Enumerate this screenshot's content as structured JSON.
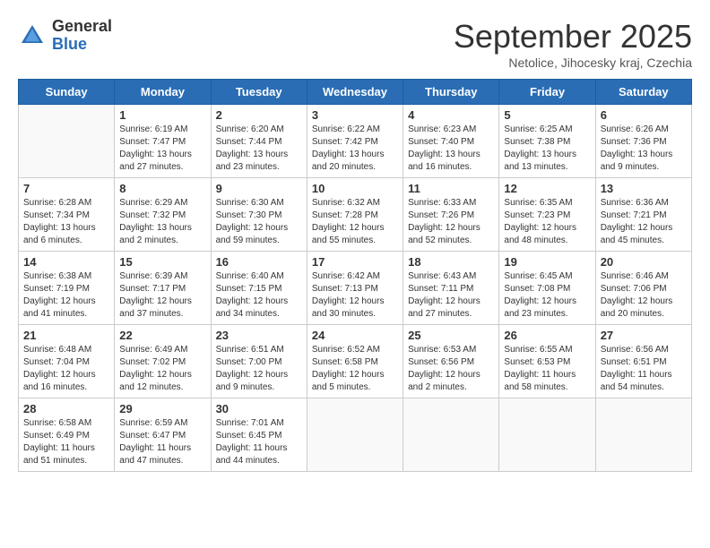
{
  "logo": {
    "general": "General",
    "blue": "Blue"
  },
  "header": {
    "month": "September 2025",
    "location": "Netolice, Jihocesky kraj, Czechia"
  },
  "days_of_week": [
    "Sunday",
    "Monday",
    "Tuesday",
    "Wednesday",
    "Thursday",
    "Friday",
    "Saturday"
  ],
  "weeks": [
    [
      {
        "day": "",
        "sunrise": "",
        "sunset": "",
        "daylight": ""
      },
      {
        "day": "1",
        "sunrise": "Sunrise: 6:19 AM",
        "sunset": "Sunset: 7:47 PM",
        "daylight": "Daylight: 13 hours and 27 minutes."
      },
      {
        "day": "2",
        "sunrise": "Sunrise: 6:20 AM",
        "sunset": "Sunset: 7:44 PM",
        "daylight": "Daylight: 13 hours and 23 minutes."
      },
      {
        "day": "3",
        "sunrise": "Sunrise: 6:22 AM",
        "sunset": "Sunset: 7:42 PM",
        "daylight": "Daylight: 13 hours and 20 minutes."
      },
      {
        "day": "4",
        "sunrise": "Sunrise: 6:23 AM",
        "sunset": "Sunset: 7:40 PM",
        "daylight": "Daylight: 13 hours and 16 minutes."
      },
      {
        "day": "5",
        "sunrise": "Sunrise: 6:25 AM",
        "sunset": "Sunset: 7:38 PM",
        "daylight": "Daylight: 13 hours and 13 minutes."
      },
      {
        "day": "6",
        "sunrise": "Sunrise: 6:26 AM",
        "sunset": "Sunset: 7:36 PM",
        "daylight": "Daylight: 13 hours and 9 minutes."
      }
    ],
    [
      {
        "day": "7",
        "sunrise": "Sunrise: 6:28 AM",
        "sunset": "Sunset: 7:34 PM",
        "daylight": "Daylight: 13 hours and 6 minutes."
      },
      {
        "day": "8",
        "sunrise": "Sunrise: 6:29 AM",
        "sunset": "Sunset: 7:32 PM",
        "daylight": "Daylight: 13 hours and 2 minutes."
      },
      {
        "day": "9",
        "sunrise": "Sunrise: 6:30 AM",
        "sunset": "Sunset: 7:30 PM",
        "daylight": "Daylight: 12 hours and 59 minutes."
      },
      {
        "day": "10",
        "sunrise": "Sunrise: 6:32 AM",
        "sunset": "Sunset: 7:28 PM",
        "daylight": "Daylight: 12 hours and 55 minutes."
      },
      {
        "day": "11",
        "sunrise": "Sunrise: 6:33 AM",
        "sunset": "Sunset: 7:26 PM",
        "daylight": "Daylight: 12 hours and 52 minutes."
      },
      {
        "day": "12",
        "sunrise": "Sunrise: 6:35 AM",
        "sunset": "Sunset: 7:23 PM",
        "daylight": "Daylight: 12 hours and 48 minutes."
      },
      {
        "day": "13",
        "sunrise": "Sunrise: 6:36 AM",
        "sunset": "Sunset: 7:21 PM",
        "daylight": "Daylight: 12 hours and 45 minutes."
      }
    ],
    [
      {
        "day": "14",
        "sunrise": "Sunrise: 6:38 AM",
        "sunset": "Sunset: 7:19 PM",
        "daylight": "Daylight: 12 hours and 41 minutes."
      },
      {
        "day": "15",
        "sunrise": "Sunrise: 6:39 AM",
        "sunset": "Sunset: 7:17 PM",
        "daylight": "Daylight: 12 hours and 37 minutes."
      },
      {
        "day": "16",
        "sunrise": "Sunrise: 6:40 AM",
        "sunset": "Sunset: 7:15 PM",
        "daylight": "Daylight: 12 hours and 34 minutes."
      },
      {
        "day": "17",
        "sunrise": "Sunrise: 6:42 AM",
        "sunset": "Sunset: 7:13 PM",
        "daylight": "Daylight: 12 hours and 30 minutes."
      },
      {
        "day": "18",
        "sunrise": "Sunrise: 6:43 AM",
        "sunset": "Sunset: 7:11 PM",
        "daylight": "Daylight: 12 hours and 27 minutes."
      },
      {
        "day": "19",
        "sunrise": "Sunrise: 6:45 AM",
        "sunset": "Sunset: 7:08 PM",
        "daylight": "Daylight: 12 hours and 23 minutes."
      },
      {
        "day": "20",
        "sunrise": "Sunrise: 6:46 AM",
        "sunset": "Sunset: 7:06 PM",
        "daylight": "Daylight: 12 hours and 20 minutes."
      }
    ],
    [
      {
        "day": "21",
        "sunrise": "Sunrise: 6:48 AM",
        "sunset": "Sunset: 7:04 PM",
        "daylight": "Daylight: 12 hours and 16 minutes."
      },
      {
        "day": "22",
        "sunrise": "Sunrise: 6:49 AM",
        "sunset": "Sunset: 7:02 PM",
        "daylight": "Daylight: 12 hours and 12 minutes."
      },
      {
        "day": "23",
        "sunrise": "Sunrise: 6:51 AM",
        "sunset": "Sunset: 7:00 PM",
        "daylight": "Daylight: 12 hours and 9 minutes."
      },
      {
        "day": "24",
        "sunrise": "Sunrise: 6:52 AM",
        "sunset": "Sunset: 6:58 PM",
        "daylight": "Daylight: 12 hours and 5 minutes."
      },
      {
        "day": "25",
        "sunrise": "Sunrise: 6:53 AM",
        "sunset": "Sunset: 6:56 PM",
        "daylight": "Daylight: 12 hours and 2 minutes."
      },
      {
        "day": "26",
        "sunrise": "Sunrise: 6:55 AM",
        "sunset": "Sunset: 6:53 PM",
        "daylight": "Daylight: 11 hours and 58 minutes."
      },
      {
        "day": "27",
        "sunrise": "Sunrise: 6:56 AM",
        "sunset": "Sunset: 6:51 PM",
        "daylight": "Daylight: 11 hours and 54 minutes."
      }
    ],
    [
      {
        "day": "28",
        "sunrise": "Sunrise: 6:58 AM",
        "sunset": "Sunset: 6:49 PM",
        "daylight": "Daylight: 11 hours and 51 minutes."
      },
      {
        "day": "29",
        "sunrise": "Sunrise: 6:59 AM",
        "sunset": "Sunset: 6:47 PM",
        "daylight": "Daylight: 11 hours and 47 minutes."
      },
      {
        "day": "30",
        "sunrise": "Sunrise: 7:01 AM",
        "sunset": "Sunset: 6:45 PM",
        "daylight": "Daylight: 11 hours and 44 minutes."
      },
      {
        "day": "",
        "sunrise": "",
        "sunset": "",
        "daylight": ""
      },
      {
        "day": "",
        "sunrise": "",
        "sunset": "",
        "daylight": ""
      },
      {
        "day": "",
        "sunrise": "",
        "sunset": "",
        "daylight": ""
      },
      {
        "day": "",
        "sunrise": "",
        "sunset": "",
        "daylight": ""
      }
    ]
  ]
}
